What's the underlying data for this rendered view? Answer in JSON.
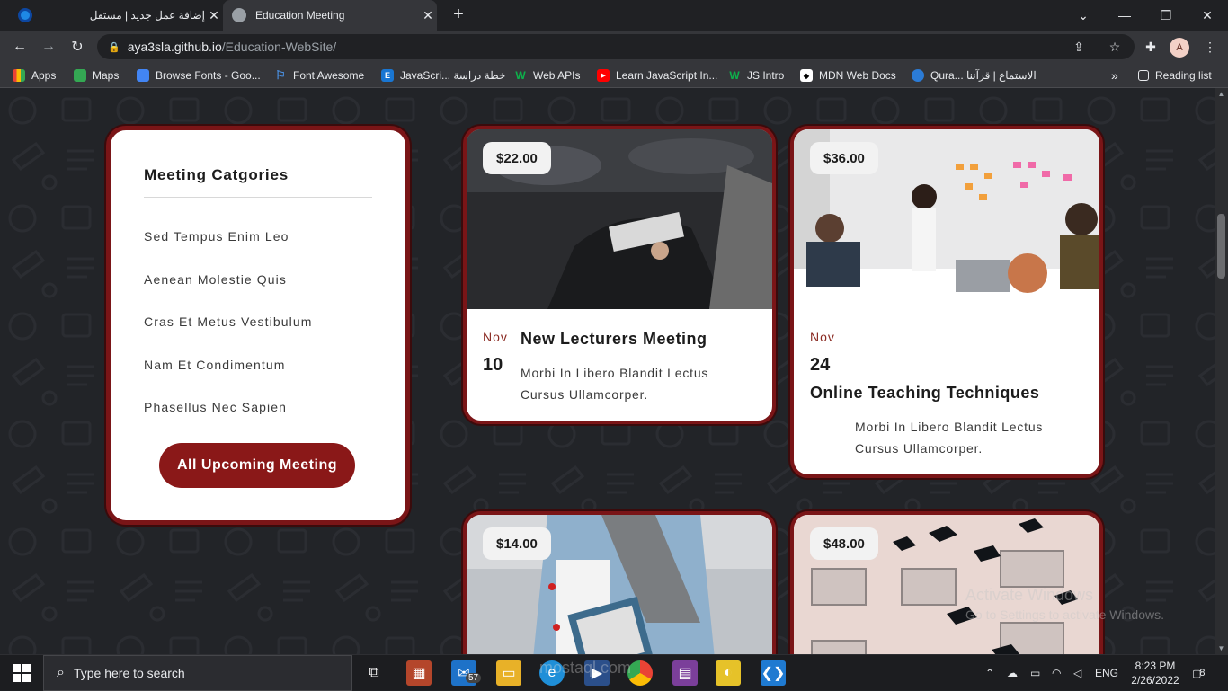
{
  "browser": {
    "tabs": [
      {
        "title": "إضافة عمل جديد | مستقل",
        "active": false
      },
      {
        "title": "Education Meeting",
        "active": true
      }
    ],
    "url_host": "aya3sla.github.io",
    "url_path": "/Education-WebSite/",
    "profile_initial": "A",
    "bookmarks": [
      {
        "label": "Apps",
        "icon": "apps-grid-icon"
      },
      {
        "label": "Maps",
        "icon": "maps-pin-icon"
      },
      {
        "label": "Browse Fonts - Goo...",
        "icon": "google-fonts-icon"
      },
      {
        "label": "Font Awesome",
        "icon": "flag-icon"
      },
      {
        "label": "JavaScri... خطة دراسة",
        "icon": "e-letter-icon"
      },
      {
        "label": "Web APIs",
        "icon": "w-letter-icon"
      },
      {
        "label": "Learn JavaScript In...",
        "icon": "youtube-icon"
      },
      {
        "label": "JS Intro",
        "icon": "w-letter-icon"
      },
      {
        "label": "MDN Web Docs",
        "icon": "mdn-icon"
      },
      {
        "label": "Qura... الاستماع | قرآننا",
        "icon": "quran-icon"
      }
    ],
    "more_bookmarks": "»",
    "reading_list": "Reading list"
  },
  "sidebar": {
    "title": "Meeting Catgories",
    "categories": [
      "Sed Tempus Enim Leo",
      "Aenean Molestie Quis",
      "Cras Et Metus Vestibulum",
      "Nam Et Condimentum",
      "Phasellus Nec Sapien"
    ],
    "button": "All Upcoming Meeting"
  },
  "meetings": [
    {
      "price": "$22.00",
      "month": "Nov",
      "day": "10",
      "title": "New Lecturers Meeting",
      "desc1": "Morbi In Libero Blandit Lectus",
      "desc2": "Cursus Ullamcorper."
    },
    {
      "price": "$36.00",
      "month": "Nov",
      "day": "24",
      "title": "Online Teaching Techniques",
      "desc1": "Morbi In Libero Blandit Lectus",
      "desc2": "Cursus Ullamcorper."
    },
    {
      "price": "$14.00"
    },
    {
      "price": "$48.00"
    }
  ],
  "overlay": {
    "activate_line1": "Activate Windows",
    "activate_line2": "Go to Settings to activate Windows.",
    "site_watermark": "mostaql.com"
  },
  "taskbar": {
    "search_placeholder": "Type here to search",
    "mail_badge": "57",
    "language": "ENG",
    "time": "8:23 PM",
    "date": "2/26/2022",
    "notification_count": "8"
  },
  "colors": {
    "accent": "#8a1818",
    "card_border": "#7a1517",
    "month": "#8a2a22"
  }
}
